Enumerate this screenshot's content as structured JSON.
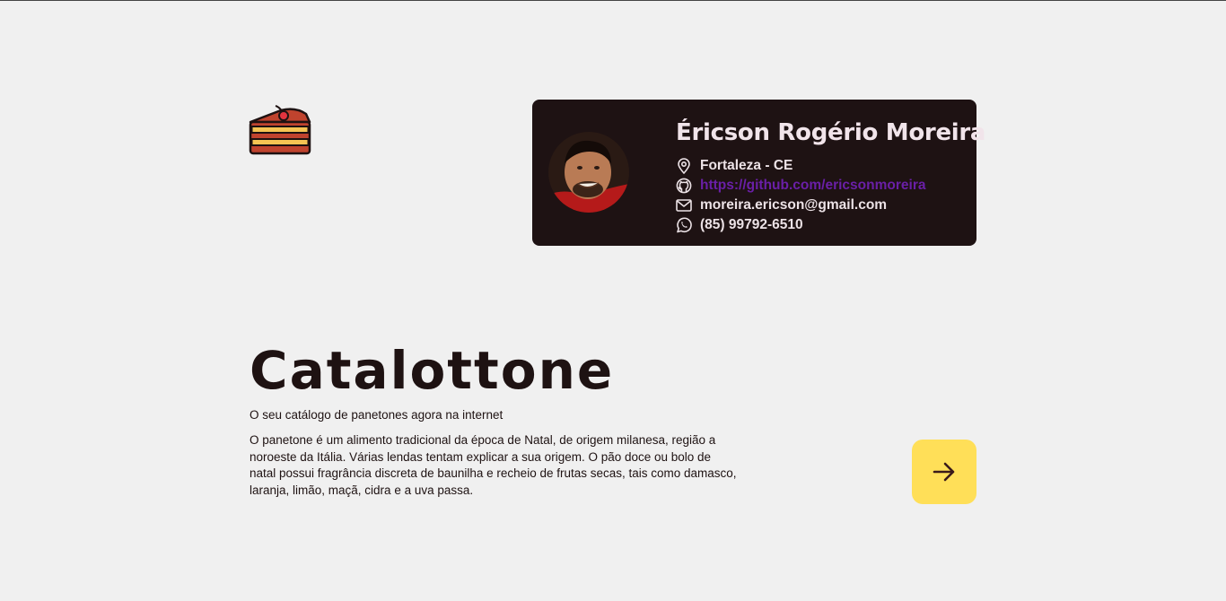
{
  "logo": {
    "icon": "cake-slice-icon"
  },
  "profile": {
    "name": "Éricson Rogério Moreira",
    "location": "Fortaleza - CE",
    "github": "https://github.com/ericsonmoreira",
    "email": "moreira.ericson@gmail.com",
    "phone": "(85) 99792-6510",
    "icons": [
      "map-pin-icon",
      "github-icon",
      "mail-icon",
      "whatsapp-icon"
    ],
    "card_color": "#1e1213",
    "link_color": "#6a1fa7"
  },
  "hero": {
    "title": "Catalottone",
    "subtitle": "O seu catálogo de panetones agora na internet",
    "description": "O panetone é um alimento tradicional da época de Natal, de origem milanesa, região a noroeste da Itália. Várias lendas tentam explicar a sua origem. O pão doce ou bolo de natal possui fragrância discreta de baunilha e recheio de frutas secas, tais como damasco, laranja, limão, maçã, cidra e a uva passa."
  },
  "action": {
    "icon": "arrow-right-icon",
    "color": "#ffdf58"
  }
}
